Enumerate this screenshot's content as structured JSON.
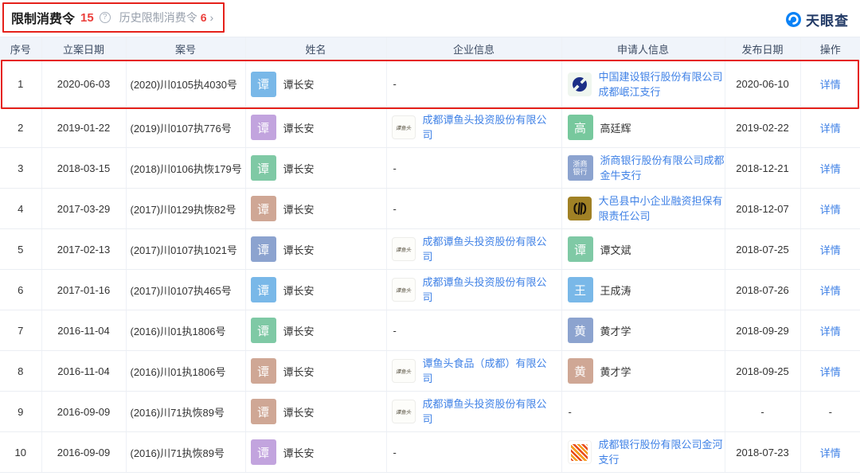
{
  "header": {
    "title": "限制消费令",
    "count": "15",
    "help_icon": "?",
    "history_label": "历史限制消费令",
    "history_count": "6",
    "history_arrow": "›"
  },
  "brand": {
    "name": "天眼查"
  },
  "colors": {
    "link_blue": "#3f81e6",
    "annotation_red": "#e5211a",
    "count_red": "#eb3f3b",
    "header_bg": "#f0f4fa"
  },
  "table": {
    "columns": [
      "序号",
      "立案日期",
      "案号",
      "姓名",
      "企业信息",
      "申请人信息",
      "发布日期",
      "操作"
    ],
    "rows": [
      {
        "no": "1",
        "filing_date": "2020-06-03",
        "case_no": "(2020)川0105执4030号",
        "person": {
          "avatar_text": "谭",
          "avatar_color": "#79b8e8",
          "name": "谭长安"
        },
        "company": {
          "text": "-"
        },
        "applicant": {
          "logo": "ccb-logo",
          "name": "中国建设银行股份有限公司成都岷江支行"
        },
        "publish_date": "2020-06-10",
        "action": "详情"
      },
      {
        "no": "2",
        "filing_date": "2019-01-22",
        "case_no": "(2019)川0107执776号",
        "person": {
          "avatar_text": "谭",
          "avatar_color": "#c2a4de",
          "name": "谭长安"
        },
        "company": {
          "logo_text": "谭鱼头",
          "name": "成都谭鱼头投资股份有限公司"
        },
        "applicant": {
          "avatar_text": "高",
          "avatar_color": "#77c89d",
          "name": "高廷辉"
        },
        "publish_date": "2019-02-22",
        "action": "详情"
      },
      {
        "no": "3",
        "filing_date": "2018-03-15",
        "case_no": "(2018)川0106执恢179号",
        "person": {
          "avatar_text": "谭",
          "avatar_color": "#7fc9a5",
          "name": "谭长安"
        },
        "company": {
          "text": "-"
        },
        "applicant": {
          "avatar_line1": "浙商",
          "avatar_line2": "银行",
          "avatar_color": "#8ca3cf",
          "name": "浙商银行股份有限公司成都金牛支行"
        },
        "publish_date": "2018-12-21",
        "action": "详情"
      },
      {
        "no": "4",
        "filing_date": "2017-03-29",
        "case_no": "(2017)川0129执恢82号",
        "person": {
          "avatar_text": "谭",
          "avatar_color": "#cfa795",
          "name": "谭长安"
        },
        "company": {
          "text": "-"
        },
        "applicant": {
          "logo": "dyb-logo",
          "name": "大邑县中小企业融资担保有限责任公司"
        },
        "publish_date": "2018-12-07",
        "action": "详情"
      },
      {
        "no": "5",
        "filing_date": "2017-02-13",
        "case_no": "(2017)川0107执1021号",
        "person": {
          "avatar_text": "谭",
          "avatar_color": "#8ca3cf",
          "name": "谭长安"
        },
        "company": {
          "logo_text": "谭鱼头",
          "name": "成都谭鱼头投资股份有限公司"
        },
        "applicant": {
          "avatar_text": "谭",
          "avatar_color": "#7fc9a5",
          "name": "谭文斌"
        },
        "publish_date": "2018-07-25",
        "action": "详情"
      },
      {
        "no": "6",
        "filing_date": "2017-01-16",
        "case_no": "(2017)川0107执465号",
        "person": {
          "avatar_text": "谭",
          "avatar_color": "#79b8e8",
          "name": "谭长安"
        },
        "company": {
          "logo_text": "谭鱼头",
          "name": "成都谭鱼头投资股份有限公司"
        },
        "applicant": {
          "avatar_text": "王",
          "avatar_color": "#79b8e8",
          "name": "王成涛"
        },
        "publish_date": "2018-07-26",
        "action": "详情"
      },
      {
        "no": "7",
        "filing_date": "2016-11-04",
        "case_no": "(2016)川01执1806号",
        "person": {
          "avatar_text": "谭",
          "avatar_color": "#7fc9a5",
          "name": "谭长安"
        },
        "company": {
          "text": "-"
        },
        "applicant": {
          "avatar_text": "黄",
          "avatar_color": "#8ca3cf",
          "name": "黄才学"
        },
        "publish_date": "2018-09-29",
        "action": "详情"
      },
      {
        "no": "8",
        "filing_date": "2016-11-04",
        "case_no": "(2016)川01执1806号",
        "person": {
          "avatar_text": "谭",
          "avatar_color": "#cfa795",
          "name": "谭长安"
        },
        "company": {
          "logo_text": "谭鱼头",
          "name": "谭鱼头食品（成都）有限公司"
        },
        "applicant": {
          "avatar_text": "黄",
          "avatar_color": "#cfa795",
          "name": "黄才学"
        },
        "publish_date": "2018-09-25",
        "action": "详情"
      },
      {
        "no": "9",
        "filing_date": "2016-09-09",
        "case_no": "(2016)川71执恢89号",
        "person": {
          "avatar_text": "谭",
          "avatar_color": "#cfa795",
          "name": "谭长安"
        },
        "company": {
          "logo_text": "谭鱼头",
          "name": "成都谭鱼头投资股份有限公司"
        },
        "applicant": {
          "text": "-"
        },
        "publish_date": "-",
        "action": "-"
      },
      {
        "no": "10",
        "filing_date": "2016-09-09",
        "case_no": "(2016)川71执恢89号",
        "person": {
          "avatar_text": "谭",
          "avatar_color": "#c2a4de",
          "name": "谭长安"
        },
        "company": {
          "text": "-"
        },
        "applicant": {
          "logo": "cdbank-logo",
          "name": "成都银行股份有限公司金河支行"
        },
        "publish_date": "2018-07-23",
        "action": "详情"
      }
    ]
  }
}
